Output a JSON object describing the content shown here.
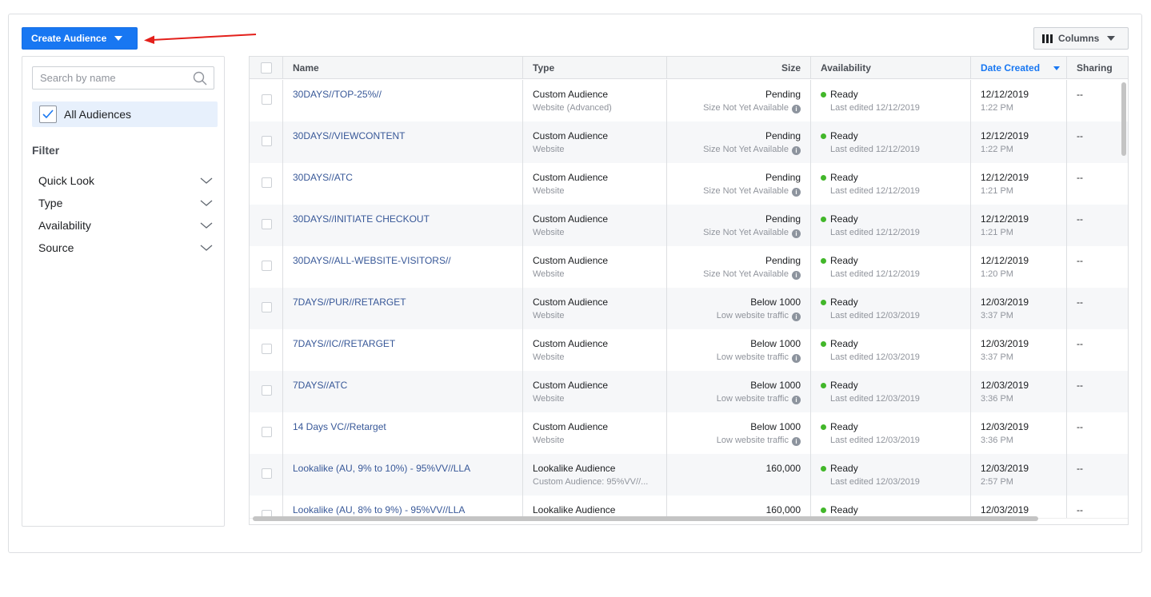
{
  "toolbar": {
    "create_label": "Create Audience",
    "columns_label": "Columns"
  },
  "sidebar": {
    "search_placeholder": "Search by name",
    "all_audiences": "All Audiences",
    "filter_title": "Filter",
    "filters": [
      "Quick Look",
      "Type",
      "Availability",
      "Source"
    ]
  },
  "table": {
    "headers": {
      "name": "Name",
      "type": "Type",
      "size": "Size",
      "availability": "Availability",
      "date_created": "Date Created",
      "sharing": "Sharing"
    },
    "rows": [
      {
        "name": "30DAYS//TOP-25%//",
        "type": "Custom Audience",
        "type_sub": "Website (Advanced)",
        "size": "Pending",
        "size_sub": "Size Not Yet Available",
        "avail": "Ready",
        "avail_sub": "Last edited 12/12/2019",
        "date": "12/12/2019",
        "time": "1:22 PM",
        "sharing": "--"
      },
      {
        "name": "30DAYS//VIEWCONTENT",
        "type": "Custom Audience",
        "type_sub": "Website",
        "size": "Pending",
        "size_sub": "Size Not Yet Available",
        "avail": "Ready",
        "avail_sub": "Last edited 12/12/2019",
        "date": "12/12/2019",
        "time": "1:22 PM",
        "sharing": "--"
      },
      {
        "name": "30DAYS//ATC",
        "type": "Custom Audience",
        "type_sub": "Website",
        "size": "Pending",
        "size_sub": "Size Not Yet Available",
        "avail": "Ready",
        "avail_sub": "Last edited 12/12/2019",
        "date": "12/12/2019",
        "time": "1:21 PM",
        "sharing": "--"
      },
      {
        "name": "30DAYS//INITIATE CHECKOUT",
        "type": "Custom Audience",
        "type_sub": "Website",
        "size": "Pending",
        "size_sub": "Size Not Yet Available",
        "avail": "Ready",
        "avail_sub": "Last edited 12/12/2019",
        "date": "12/12/2019",
        "time": "1:21 PM",
        "sharing": "--"
      },
      {
        "name": "30DAYS//ALL-WEBSITE-VISITORS//",
        "type": "Custom Audience",
        "type_sub": "Website",
        "size": "Pending",
        "size_sub": "Size Not Yet Available",
        "avail": "Ready",
        "avail_sub": "Last edited 12/12/2019",
        "date": "12/12/2019",
        "time": "1:20 PM",
        "sharing": "--"
      },
      {
        "name": "7DAYS//PUR//RETARGET",
        "type": "Custom Audience",
        "type_sub": "Website",
        "size": "Below 1000",
        "size_sub": "Low website traffic",
        "avail": "Ready",
        "avail_sub": "Last edited 12/03/2019",
        "date": "12/03/2019",
        "time": "3:37 PM",
        "sharing": "--"
      },
      {
        "name": "7DAYS//IC//RETARGET",
        "type": "Custom Audience",
        "type_sub": "Website",
        "size": "Below 1000",
        "size_sub": "Low website traffic",
        "avail": "Ready",
        "avail_sub": "Last edited 12/03/2019",
        "date": "12/03/2019",
        "time": "3:37 PM",
        "sharing": "--"
      },
      {
        "name": "7DAYS//ATC",
        "type": "Custom Audience",
        "type_sub": "Website",
        "size": "Below 1000",
        "size_sub": "Low website traffic",
        "avail": "Ready",
        "avail_sub": "Last edited 12/03/2019",
        "date": "12/03/2019",
        "time": "3:36 PM",
        "sharing": "--"
      },
      {
        "name": "14 Days VC//Retarget",
        "type": "Custom Audience",
        "type_sub": "Website",
        "size": "Below 1000",
        "size_sub": "Low website traffic",
        "avail": "Ready",
        "avail_sub": "Last edited 12/03/2019",
        "date": "12/03/2019",
        "time": "3:36 PM",
        "sharing": "--"
      },
      {
        "name": "Lookalike (AU, 9% to 10%) - 95%VV//LLA",
        "type": "Lookalike Audience",
        "type_sub": "Custom Audience: 95%VV//...",
        "size": "160,000",
        "size_sub": "",
        "avail": "Ready",
        "avail_sub": "Last edited 12/03/2019",
        "date": "12/03/2019",
        "time": "2:57 PM",
        "sharing": "--"
      },
      {
        "name": "Lookalike (AU, 8% to 9%) - 95%VV//LLA",
        "type": "Lookalike Audience",
        "type_sub": "",
        "size": "160,000",
        "size_sub": "",
        "avail": "Ready",
        "avail_sub": "",
        "date": "12/03/2019",
        "time": "",
        "sharing": "--"
      }
    ]
  },
  "colors": {
    "primary": "#1877f2",
    "link": "#385898",
    "ready_dot": "#42b72a",
    "annotation_arrow": "#e3201b"
  }
}
